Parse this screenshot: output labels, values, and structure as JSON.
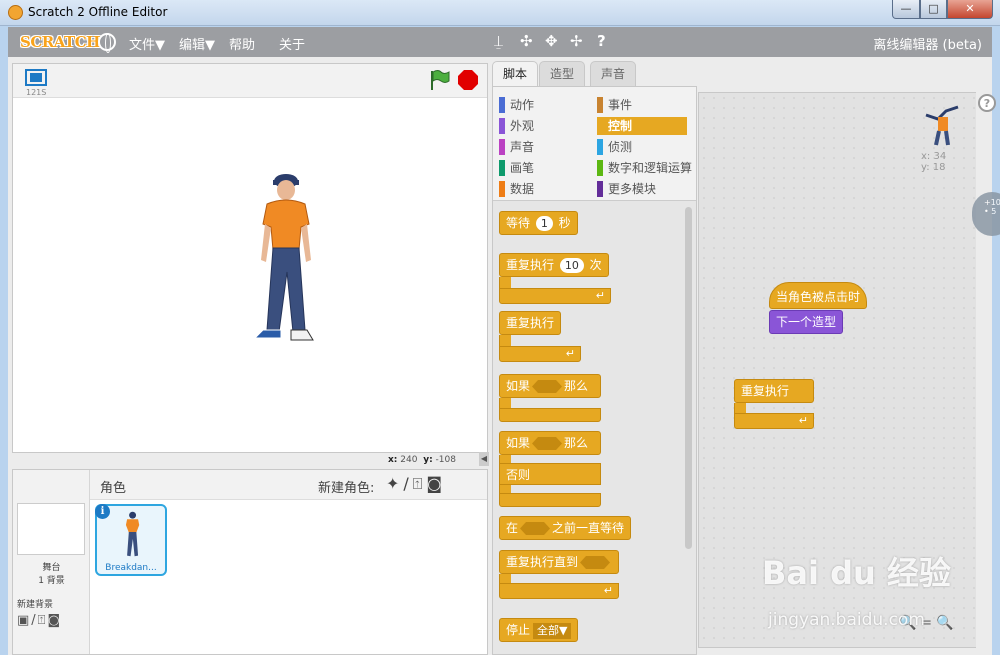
{
  "window": {
    "title": "Scratch 2 Offline Editor",
    "min_glyph": "—",
    "max_glyph": "□",
    "close_glyph": "✕"
  },
  "menubar": {
    "logo": "SCRATCH",
    "file": "文件▼",
    "edit": "编辑▼",
    "help": "帮助",
    "about": "关于",
    "tools": [
      "⍊",
      "✣",
      "✥",
      "✢",
      "?"
    ],
    "editor_label": "离线编辑器 (beta)"
  },
  "stage": {
    "version": "121S",
    "x_label": "x:",
    "x_value": "240",
    "y_label": "y:",
    "y_value": "-108"
  },
  "sprite_pane": {
    "stage_name": "舞台",
    "backdrop_count": "1 背景",
    "new_backdrop_label": "新建背景",
    "backdrop_tools": "▣/⍐◙",
    "sprites_title": "角色",
    "new_sprite_label": "新建角色:",
    "new_sprite_tools": "✦/⍐◙",
    "sprite_name": "Breakdan...",
    "info": "i"
  },
  "tabs": [
    "脚本",
    "造型",
    "声音"
  ],
  "categories": [
    {
      "label": "动作",
      "color": "#4a6cd4"
    },
    {
      "label": "事件",
      "color": "#c88330"
    },
    {
      "label": "外观",
      "color": "#8a55d7"
    },
    {
      "label": "控制",
      "color": "#e6a822",
      "selected": true
    },
    {
      "label": "声音",
      "color": "#bb42c3"
    },
    {
      "label": "侦测",
      "color": "#2ca5e2"
    },
    {
      "label": "画笔",
      "color": "#0e9a6c"
    },
    {
      "label": "数字和逻辑运算",
      "color": "#5cb712"
    },
    {
      "label": "数据",
      "color": "#ee7d16"
    },
    {
      "label": "更多模块",
      "color": "#632d99"
    }
  ],
  "palette_blocks": {
    "wait": "等待",
    "wait_value": "1",
    "wait_unit": "秒",
    "repeat": "重复执行",
    "repeat_value": "10",
    "repeat_unit": "次",
    "forever": "重复执行",
    "if": "如果",
    "then": "那么",
    "if_else": "如果",
    "then2": "那么",
    "else": "否则",
    "wait_until_prefix": "在",
    "wait_until_suffix": "之前一直等待",
    "repeat_until": "重复执行直到",
    "stop": "停止",
    "stop_option": "全部▼"
  },
  "script_area": {
    "hat_block": "当角色被点击时",
    "looks_block": "下一个造型",
    "forever_block": "重复执行",
    "corner_x": "x: 34",
    "corner_y": "y: 18",
    "help": "?",
    "zoom_tools": "🔍=🔍"
  },
  "side_widget": {
    "line1": "+10",
    "line2": "• 5"
  },
  "watermark": {
    "main": "Bai du 经验",
    "sub": "jingyan.baidu.com"
  }
}
